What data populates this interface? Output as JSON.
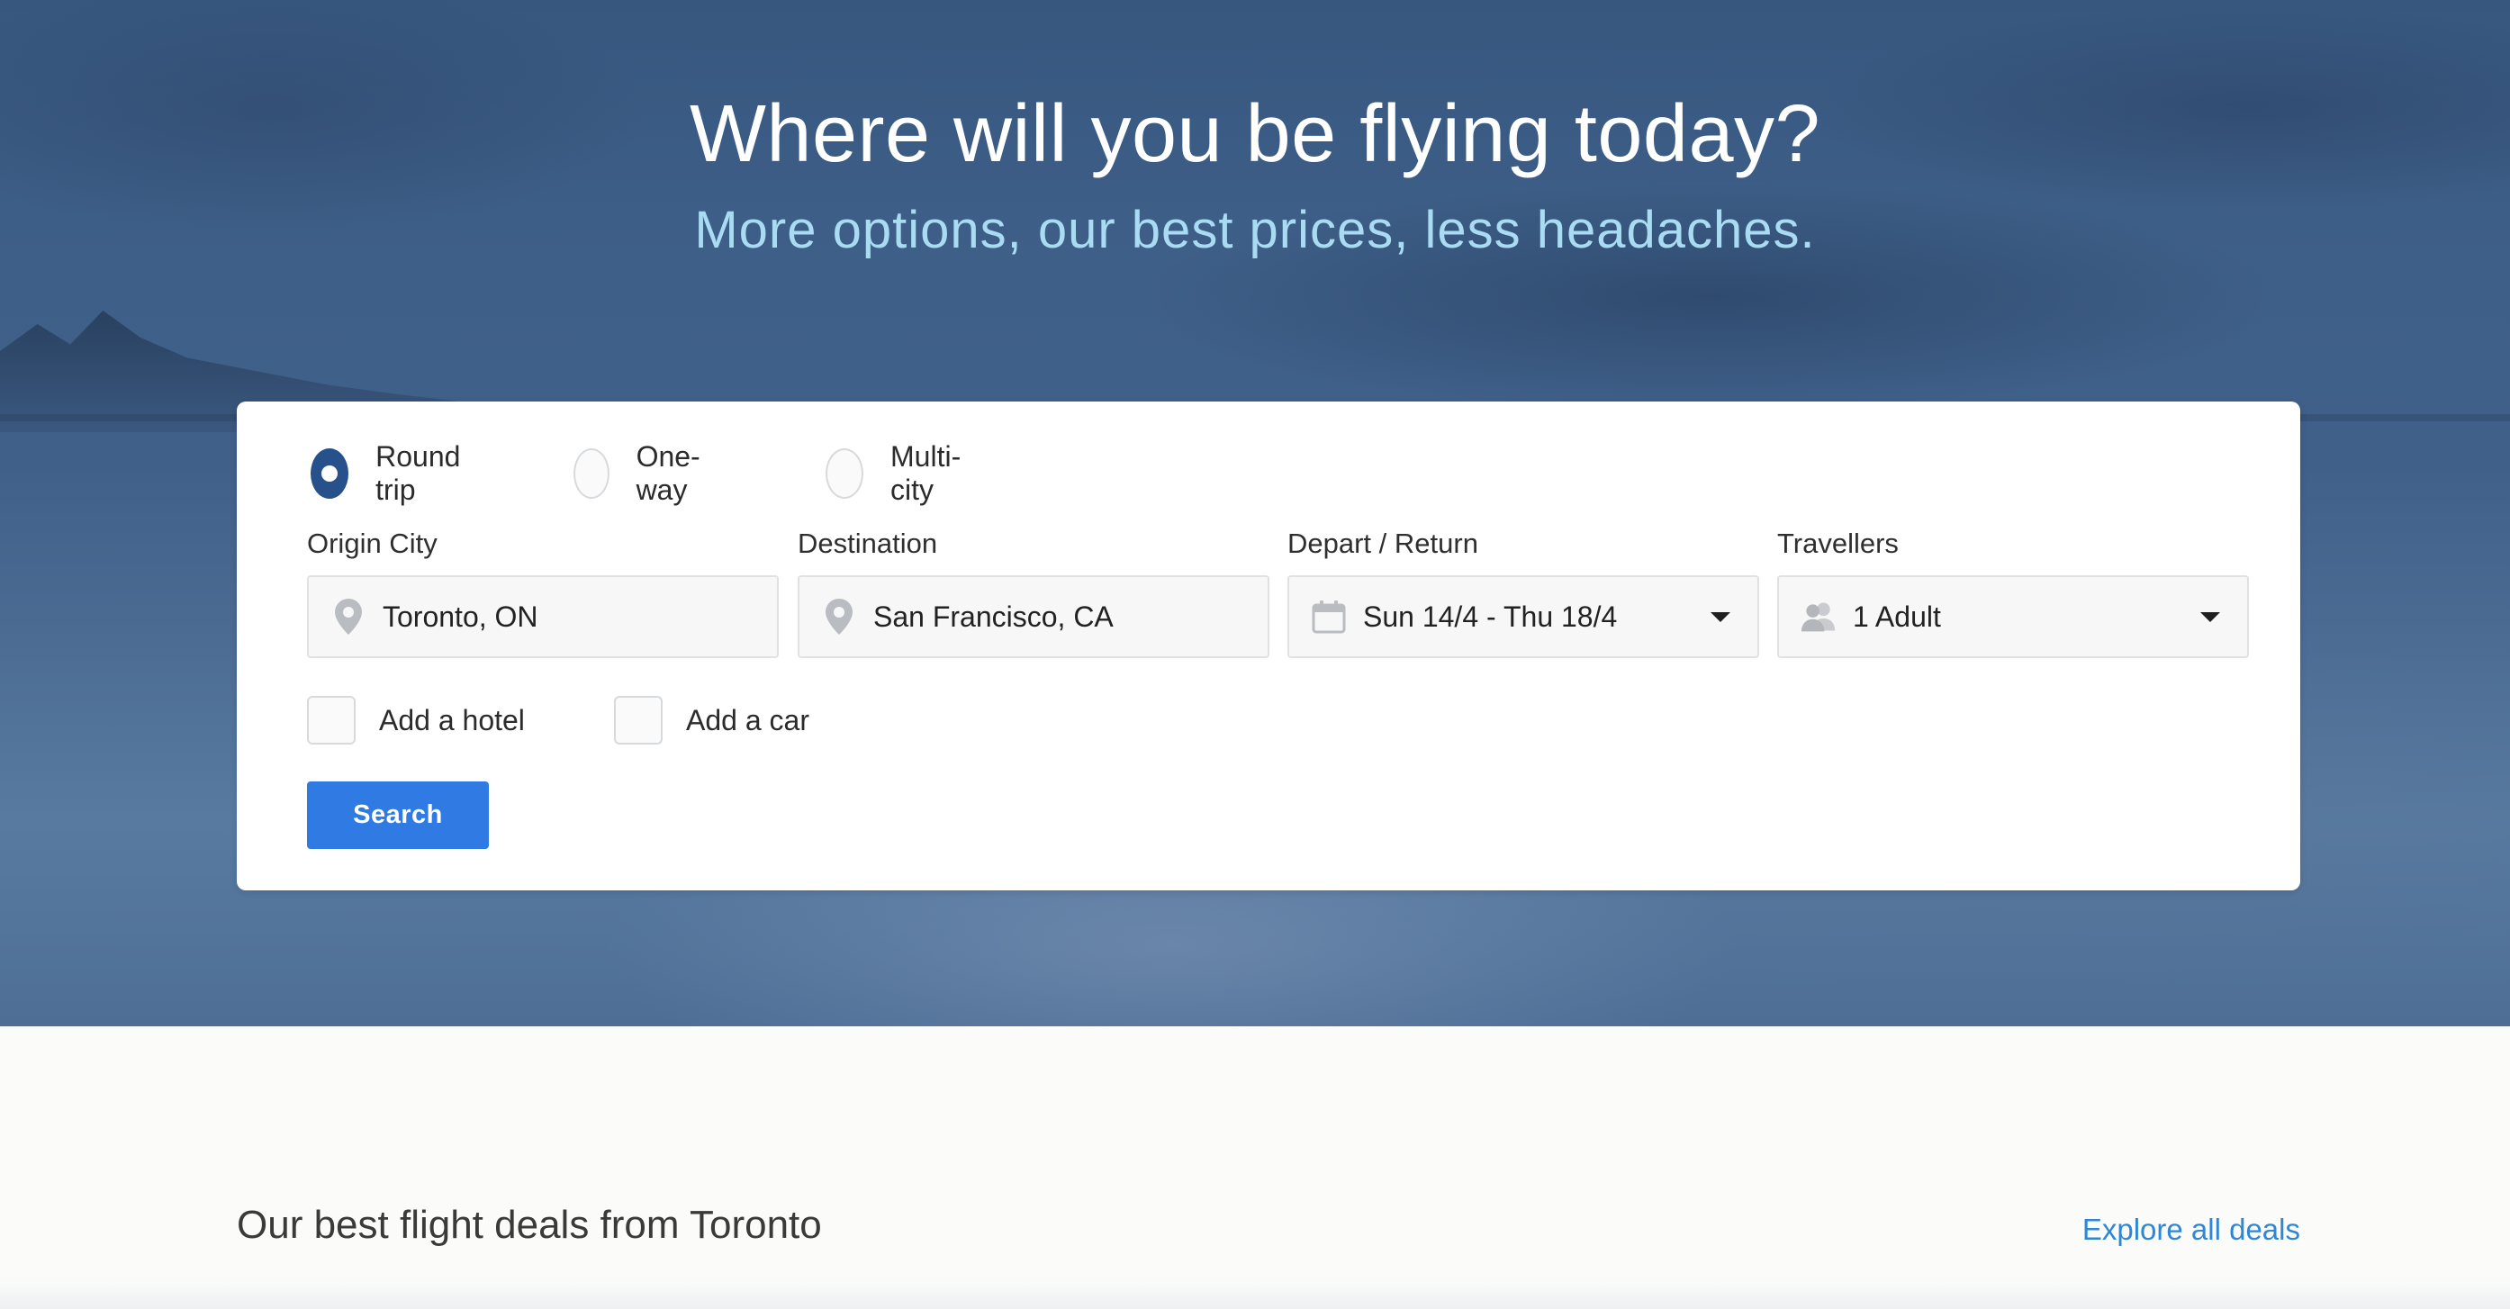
{
  "hero": {
    "title": "Where will you be flying today?",
    "subtitle": "More options, our best prices, less headaches."
  },
  "search": {
    "trip_types": [
      {
        "label": "Round trip",
        "selected": true
      },
      {
        "label": "One-way",
        "selected": false
      },
      {
        "label": "Multi-city",
        "selected": false
      }
    ],
    "origin": {
      "label": "Origin City",
      "value": "Toronto, ON",
      "icon": "map-pin-icon"
    },
    "destination": {
      "label": "Destination",
      "value": "San Francisco, CA",
      "icon": "map-pin-icon"
    },
    "dates": {
      "label": "Depart / Return",
      "value": "Sun 14/4 - Thu 18/4",
      "icon": "calendar-icon"
    },
    "travellers": {
      "label": "Travellers",
      "value": "1 Adult",
      "icon": "people-icon"
    },
    "addons": [
      {
        "label": "Add a hotel",
        "checked": false
      },
      {
        "label": "Add a car",
        "checked": false
      }
    ],
    "search_label": "Search"
  },
  "deals": {
    "title": "Our best flight deals from Toronto",
    "link": "Explore all deals"
  },
  "colors": {
    "accent": "#2f7be3",
    "radio_selected": "#26518b",
    "subtitle": "#a9dbf2",
    "link": "#2f86d4"
  }
}
